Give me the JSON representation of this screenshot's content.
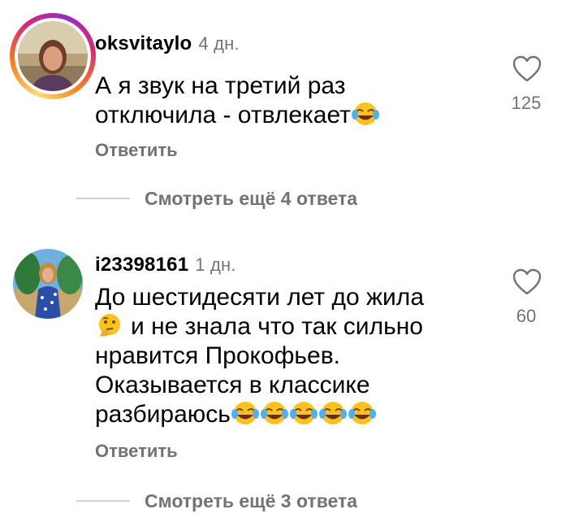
{
  "comments": [
    {
      "username": "oksvitaylo",
      "time": "4 дн.",
      "text_line1": "А я звук на третий раз",
      "text_line2": "отключила - отвлекает",
      "reply_label": "Ответить",
      "likes": "125",
      "avatar": "profile-photo-with-story-ring"
    },
    {
      "username": "i23398161",
      "time": "1 дн.",
      "text_line1": "До шестидесяти лет до жила",
      "text_line2": "и не знала что так сильно",
      "text_line3": "нравится Прокофьев.",
      "text_line4": "Оказывается в классике",
      "text_line5": "разбираюсь",
      "reply_label": "Ответить",
      "likes": "60",
      "avatar": "profile-photo"
    }
  ],
  "view_more": [
    {
      "label": "Смотреть ещё 4 ответа"
    },
    {
      "label": "Смотреть ещё 3 ответа"
    }
  ],
  "icons": {
    "like": "heart-outline-icon",
    "laughing": "face-with-tears-of-joy-emoji",
    "thinking": "thinking-face-emoji"
  },
  "colors": {
    "secondary_text": "#737373",
    "story_ring": "#d62976"
  }
}
